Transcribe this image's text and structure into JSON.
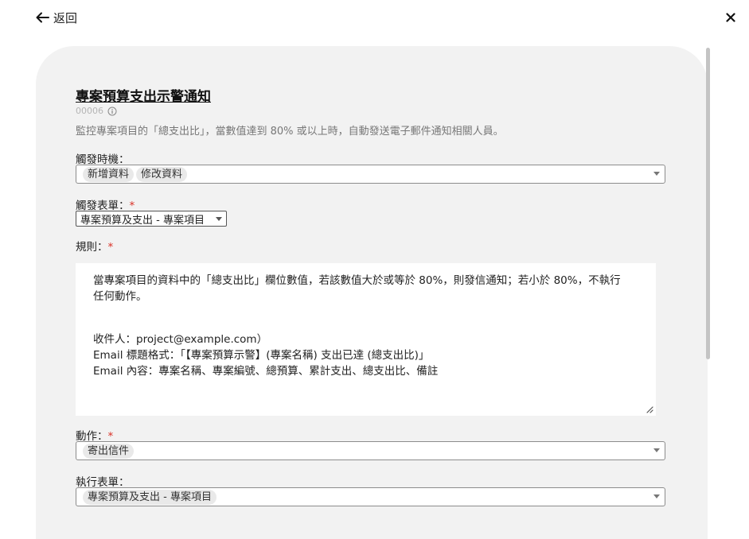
{
  "nav": {
    "back_label": "返回"
  },
  "form": {
    "title": "專案預算支出示警通知",
    "record_id": "00006",
    "description": "監控專案項目的「總支出比」，當數值達到 80% 或以上時，自動發送電子郵件通知相關人員。",
    "trigger_timing": {
      "label": "觸發時機：",
      "chips": [
        "新增資料",
        "修改資料"
      ]
    },
    "trigger_form": {
      "label": "觸發表單：",
      "required_mark": "*",
      "value": "專案預算及支出 - 專案項目"
    },
    "rules": {
      "label": "規則：",
      "required_mark": "*",
      "line1": "當專案項目的資料中的「總支出比」欄位數值，若該數值大於或等於 80%，則發信通知；若小於 80%，不執行",
      "line2": "任何動作。",
      "line3": "收件人：project@example.com）",
      "line4": "Email 標題格式：「【專案預算示警】(專案名稱) 支出已達 (總支出比)」",
      "line5": "Email 內容：專案名稱、專案編號、總預算、累計支出、總支出比、備註"
    },
    "action": {
      "label": "動作：",
      "required_mark": "*",
      "chips": [
        "寄出信件"
      ]
    },
    "exec_form": {
      "label": "執行表單：",
      "chips": [
        "專案預算及支出 - 專案項目"
      ]
    }
  },
  "colors": {
    "card_background": "#f2f2f2",
    "required": "#d93025",
    "muted_text": "#777777",
    "chip_background": "#e9e9e9"
  },
  "icons": {
    "back": "arrow-left-icon",
    "close": "close-icon",
    "info": "info-icon",
    "dropdown": "chevron-down-icon",
    "resize": "resize-handle-icon"
  }
}
